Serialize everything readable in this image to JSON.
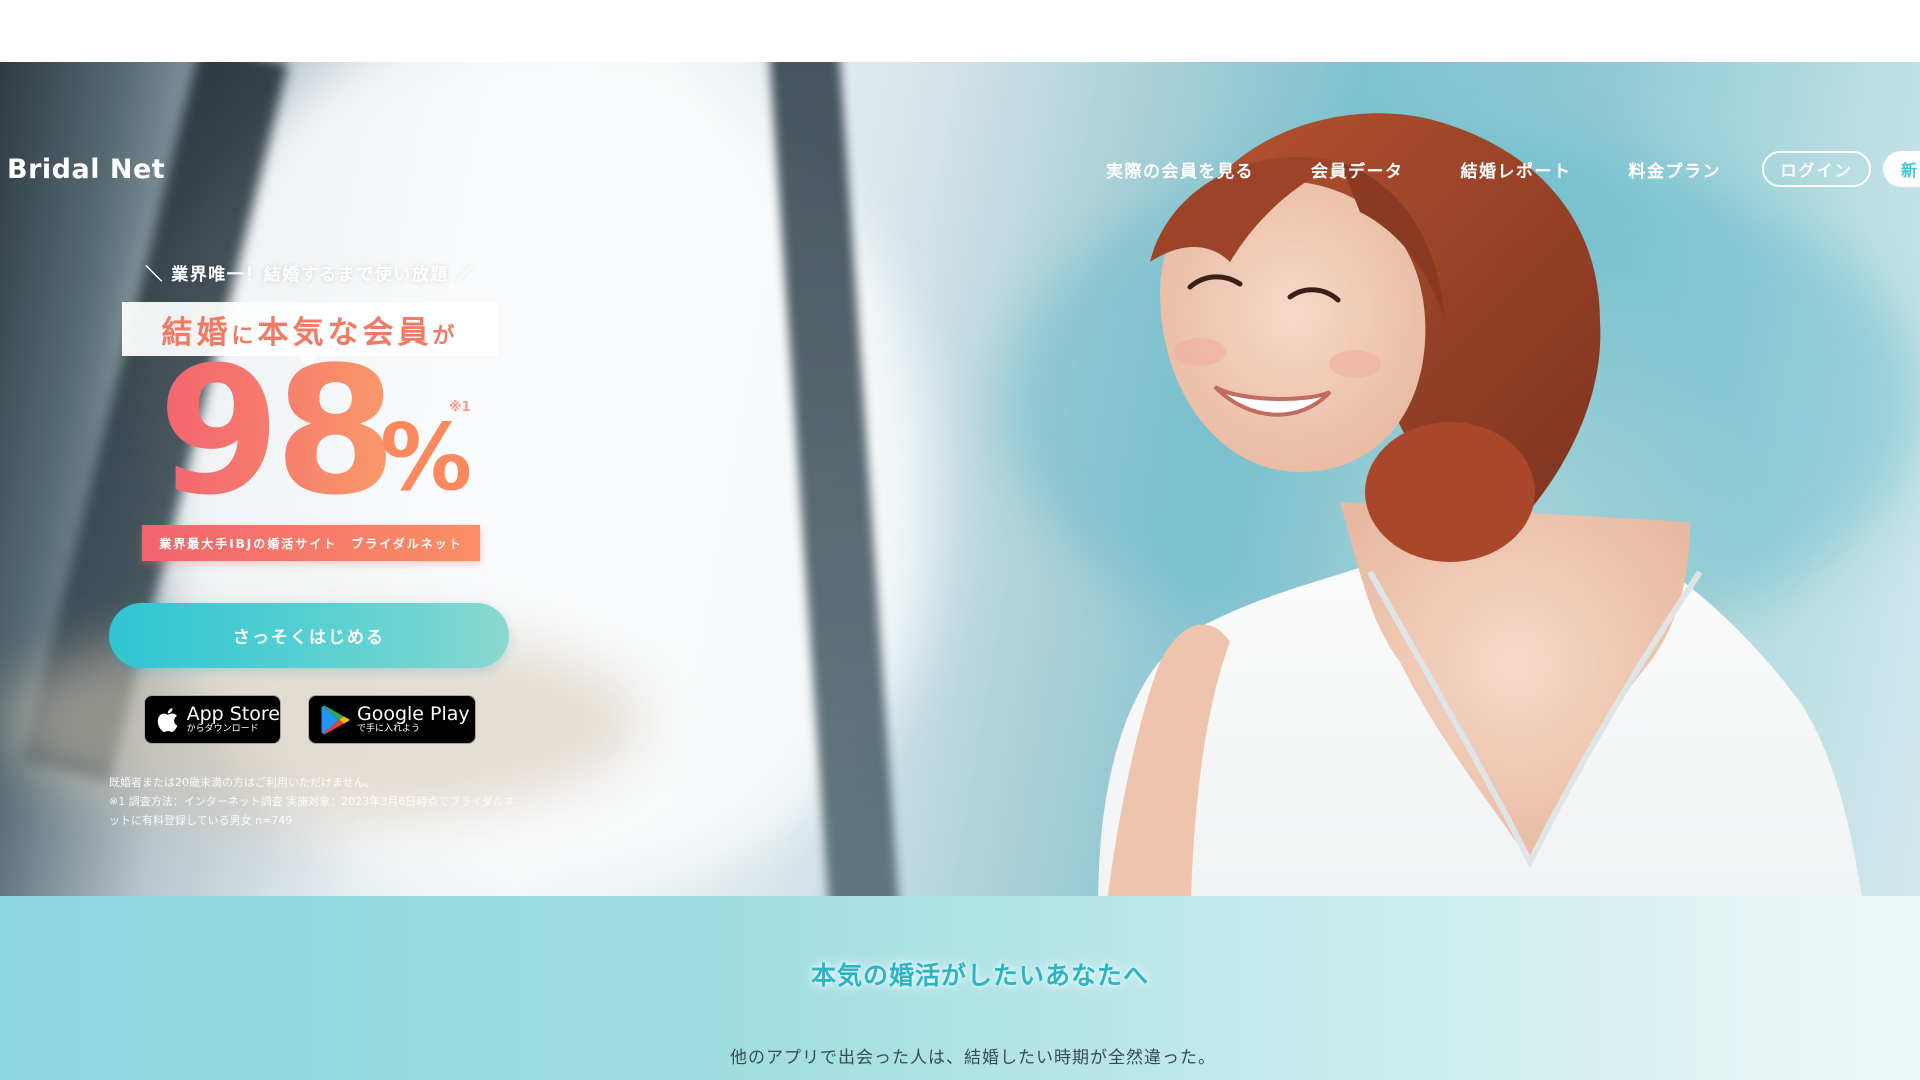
{
  "header": {
    "brand": "Bridal Net",
    "nav": [
      {
        "label": "実際の会員を見る"
      },
      {
        "label": "会員データ"
      },
      {
        "label": "結婚レポート"
      },
      {
        "label": "料金プラン"
      }
    ],
    "login_label": "ログイン",
    "signup_label": "新"
  },
  "hero": {
    "tagline": "＼ 業界唯一！結婚するまで使い放題 ／",
    "headline_part1": "結婚",
    "headline_part2": "に",
    "headline_part3": "本気な会員",
    "headline_part4": "が",
    "big_number": "98",
    "percent_sign": "%",
    "note_mark": "※1",
    "ribbon": "業界最大手IBJの婚活サイト　ブライダルネット",
    "cta_label": "さっそくはじめる",
    "appstore": {
      "big": "App Store",
      "small": "からダウンロード"
    },
    "googleplay": {
      "big": "Google Play",
      "small": "で手に入れよう"
    },
    "disclaimer_line1": "既婚者または20歳未満の方はご利用いただけません。",
    "disclaimer_line2": "※1 調査方法：インターネット調査 実施対象：2023年3月6日時点でブライダルネットに有料登録している男女 n=749"
  },
  "lower": {
    "title": "本気の婚活がしたいあなたへ",
    "text": "他のアプリで出会った人は、結婚したい時期が全然違った。"
  },
  "colors": {
    "accent_teal": "#2ec5d3",
    "accent_coral": "#f2646f",
    "accent_orange": "#fa8f64"
  }
}
